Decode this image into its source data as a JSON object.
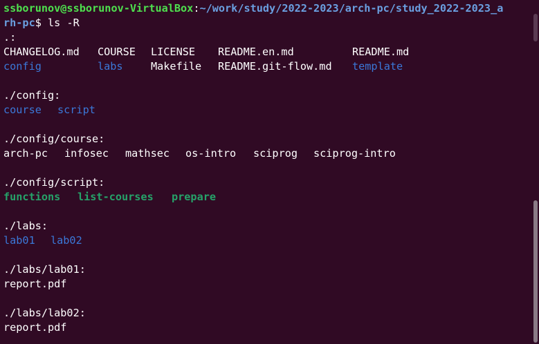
{
  "prompt": {
    "user_host": "ssborunov@ssborunov-VirtualBox",
    "colon": ":",
    "path_line1": "~/work/study/2022-2023/arch-pc/study_2022-2023_a",
    "path_line2": "rh-pc",
    "symbol": "$",
    "command": " ls -R"
  },
  "listing": {
    "root_heading": ".:",
    "root_row1": [
      "CHANGELOG.md",
      "COURSE",
      "LICENSE",
      "README.en.md",
      "README.md"
    ],
    "root_row2": [
      "config",
      "labs",
      "Makefile",
      "README.git-flow.md",
      "template"
    ],
    "config_heading": "./config:",
    "config_items": [
      "course",
      "script"
    ],
    "config_course_heading": "./config/course:",
    "config_course_items": [
      "arch-pc",
      "infosec",
      "mathsec",
      "os-intro",
      "sciprog",
      "sciprog-intro"
    ],
    "config_script_heading": "./config/script:",
    "config_script_items": [
      "functions",
      "list-courses",
      "prepare"
    ],
    "labs_heading": "./labs:",
    "labs_items": [
      "lab01",
      "lab02"
    ],
    "lab01_heading": "./labs/lab01:",
    "lab01_items": [
      "report.pdf"
    ],
    "lab02_heading": "./labs/lab02:",
    "lab02_items": [
      "report.pdf"
    ]
  },
  "colors": {
    "background": "#300a24",
    "prompt_user": "#4ee04e",
    "prompt_path": "#6a9fe0",
    "directory": "#3b78d8",
    "executable": "#26a269",
    "text": "#ffffff"
  }
}
